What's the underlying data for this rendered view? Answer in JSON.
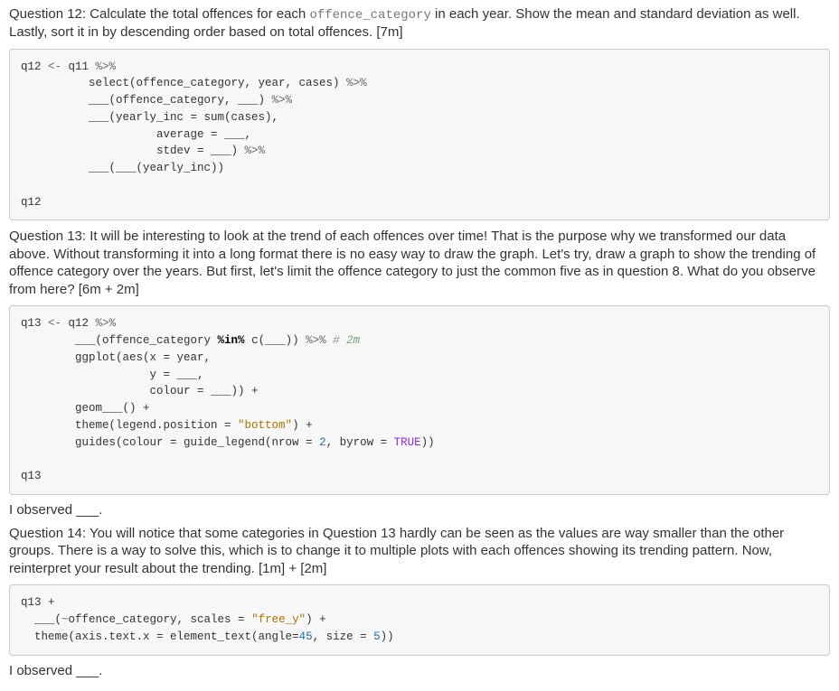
{
  "q12": {
    "prefix": "Question 12: Calculate the total offences for each ",
    "inline_code": "offence_category",
    "suffix": " in each year. Show the mean and standard deviation as well. Lastly, sort it in by descending order based on total offences. [7m]"
  },
  "code12": {
    "l1a": "q12 ",
    "l1b": "<-",
    "l1c": " q11 ",
    "l1d": "%>%",
    "l2a": "          select(offence_category, year, cases) ",
    "l2b": "%>%",
    "l3a": "          ___(offence_category, ___) ",
    "l3b": "%>%",
    "l4": "          ___(yearly_inc = sum(cases),",
    "l5": "                    average = ___,",
    "l6a": "                    stdev = ___) ",
    "l6b": "%>%",
    "l7": "          ___(___(yearly_inc))",
    "l8": "",
    "l9": "q12"
  },
  "q13": {
    "text": "Question 13: It will be interesting to look at the trend of each offences over time! That is the purpose why we transformed our data above. Without transforming it into a long format there is no easy way to draw the graph. Let's try, draw a graph to show the trending of offence category over the years. But first, let's limit the offence category to just the common five as in question 8. What do you observe from here? [6m + 2m]"
  },
  "code13": {
    "l1a": "q13 ",
    "l1b": "<-",
    "l1c": " q12 ",
    "l1d": "%>%",
    "l2a": "        ___(offence_category ",
    "l2in": "%in%",
    "l2b": " c(___)) ",
    "l2c": "%>%",
    "l2d": " ",
    "l2comm": "# 2m",
    "l3": "        ggplot(aes(x = year,",
    "l4": "                   y = ___,",
    "l5": "                   colour = ___)) +",
    "l6": "        geom___() +",
    "l7a": "        theme(legend.position = ",
    "l7str": "\"bottom\"",
    "l7b": ") +",
    "l8a": "        guides(colour = guide_legend(nrow = ",
    "l8num": "2",
    "l8b": ", byrow = ",
    "l8bool": "TRUE",
    "l8c": "))",
    "l9": "",
    "l10": "q13"
  },
  "obs13": "I observed ___.",
  "q14": {
    "text": "Question 14: You will notice that some categories in Question 13 hardly can be seen as the values are way smaller than the other groups. There is a way to solve this, which is to change it to multiple plots with each offences showing its trending pattern. Now, reinterpret your result about the trending. [1m] + [2m]"
  },
  "code14": {
    "l1": "q13 +",
    "l2a": "  ___(",
    "l2b": "~",
    "l2c": "offence_category, scales = ",
    "l2str": "\"free_y\"",
    "l2d": ") +",
    "l3a": "  theme(axis.text.x = element_text(angle=",
    "l3n1": "45",
    "l3b": ", size = ",
    "l3n2": "5",
    "l3c": "))"
  },
  "obs14": "I observed ___."
}
